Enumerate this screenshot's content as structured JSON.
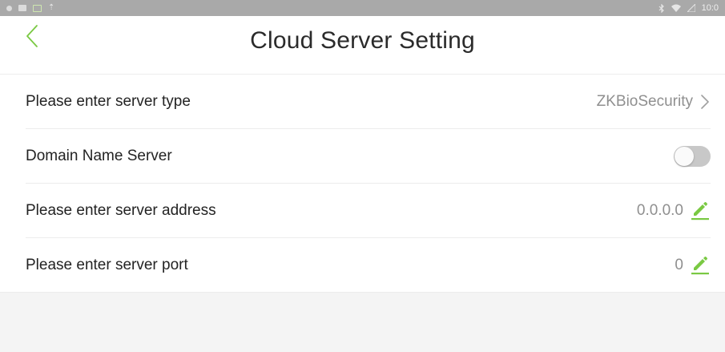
{
  "status_bar": {
    "time": "10:0",
    "left_icons": [
      "notification-dot-icon",
      "image-icon",
      "gallery-icon",
      "upload-icon"
    ],
    "right_icons": [
      "bluetooth-icon",
      "wifi-icon",
      "signal-icon"
    ]
  },
  "header": {
    "title": "Cloud Server Setting",
    "back_icon": "chevron-left-icon"
  },
  "settings": [
    {
      "label": "Please enter server type",
      "value": "ZKBioSecurity",
      "control": "chevron"
    },
    {
      "label": "Domain Name Server",
      "value": "",
      "control": "toggle",
      "toggle_on": false
    },
    {
      "label": "Please enter server address",
      "value": "0.0.0.0",
      "control": "edit"
    },
    {
      "label": "Please enter server port",
      "value": "0",
      "control": "edit"
    }
  ],
  "colors": {
    "accent": "#7ac943",
    "status_bar": "#a9a9a9",
    "toggle_off": "#c8c8c8",
    "value_text": "#8f8f8f",
    "bottom_background": "#f4f4f4"
  }
}
